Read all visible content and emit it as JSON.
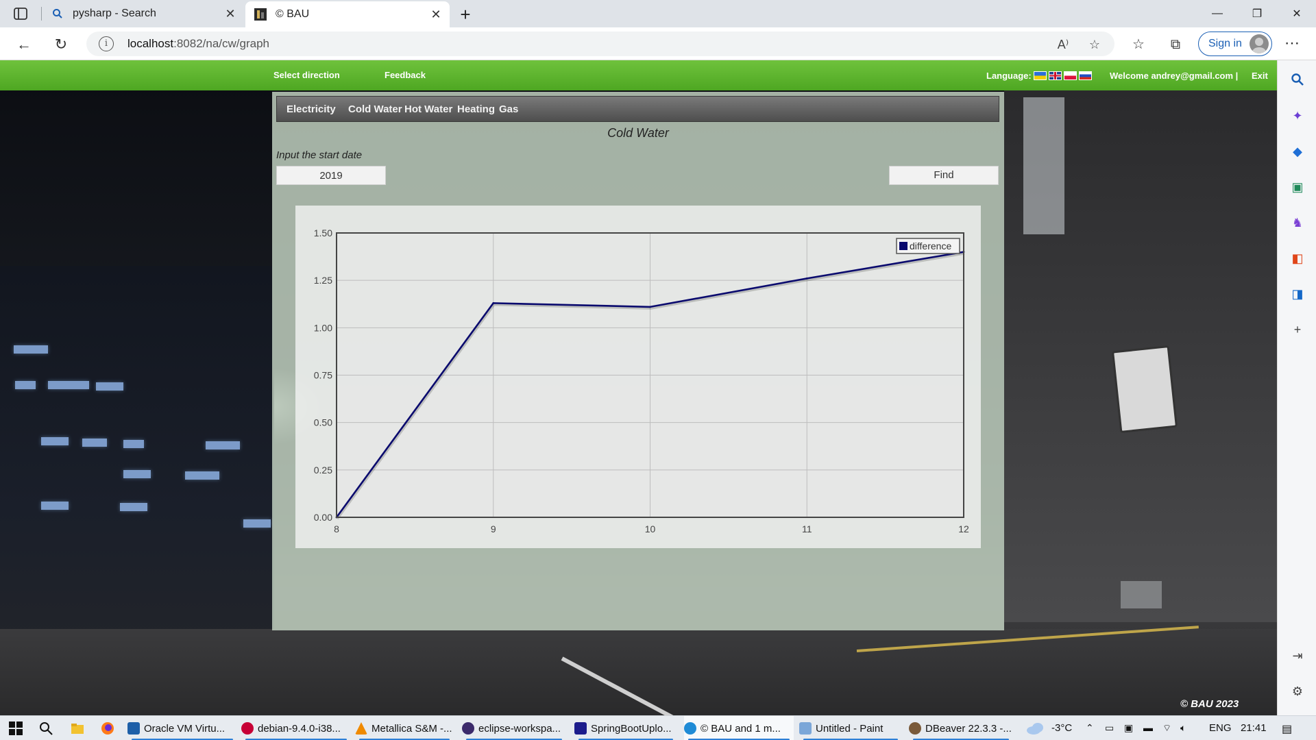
{
  "browser": {
    "tabs": [
      {
        "title": "pysharp - Search",
        "active": false,
        "icon": "search-icon"
      },
      {
        "title": "© BAU",
        "active": true,
        "icon": "site-favicon"
      }
    ],
    "url_host": "localhost",
    "url_rest": ":8082/na/cw/graph",
    "sign_in": "Sign in"
  },
  "site": {
    "nav": {
      "select_direction": "Select direction",
      "feedback": "Feedback",
      "language_label": "Language:",
      "welcome": "Welcome andrey@gmail.com |",
      "exit": "Exit"
    },
    "utility_tabs": [
      "Electricity",
      "Cold Water",
      "Hot Water",
      "Heating",
      "Gas"
    ],
    "heading": "Cold Water",
    "start_date_label": "Input the start date",
    "start_date_value": "2019",
    "find_button": "Find",
    "footer": "© BAU 2023"
  },
  "chart_data": {
    "type": "line",
    "x": [
      8,
      9,
      10,
      11,
      12
    ],
    "series": [
      {
        "name": "difference",
        "values": [
          0.0,
          1.13,
          1.11,
          1.26,
          1.4
        ],
        "color": "#0a0a6e"
      }
    ],
    "x_ticks": [
      "8",
      "9",
      "10",
      "11",
      "12"
    ],
    "y_ticks": [
      "0.00",
      "0.25",
      "0.50",
      "0.75",
      "1.00",
      "1.25",
      "1.50"
    ],
    "ylim": [
      0,
      1.5
    ],
    "xlim": [
      8,
      12
    ],
    "grid": true,
    "legend_position": "top-right"
  },
  "taskbar": {
    "apps": [
      {
        "label": "Oracle VM Virtu...",
        "color": "#1d5fa8"
      },
      {
        "label": "debian-9.4.0-i38...",
        "color": "#c70036"
      },
      {
        "label": "Metallica S&M -...",
        "color": "#f08a00"
      },
      {
        "label": "eclipse-workspa...",
        "color": "#3b2a6b"
      },
      {
        "label": "SpringBootUplo...",
        "color": "#1c1c8c"
      },
      {
        "label": "© BAU and 1 m...",
        "color": "#1f8bd6"
      },
      {
        "label": "Untitled - Paint",
        "color": "#7aa6d8"
      },
      {
        "label": "DBeaver 22.3.3 -...",
        "color": "#7a5a3a"
      }
    ],
    "weather": "-3°C",
    "language": "ENG",
    "time": "21:41"
  }
}
